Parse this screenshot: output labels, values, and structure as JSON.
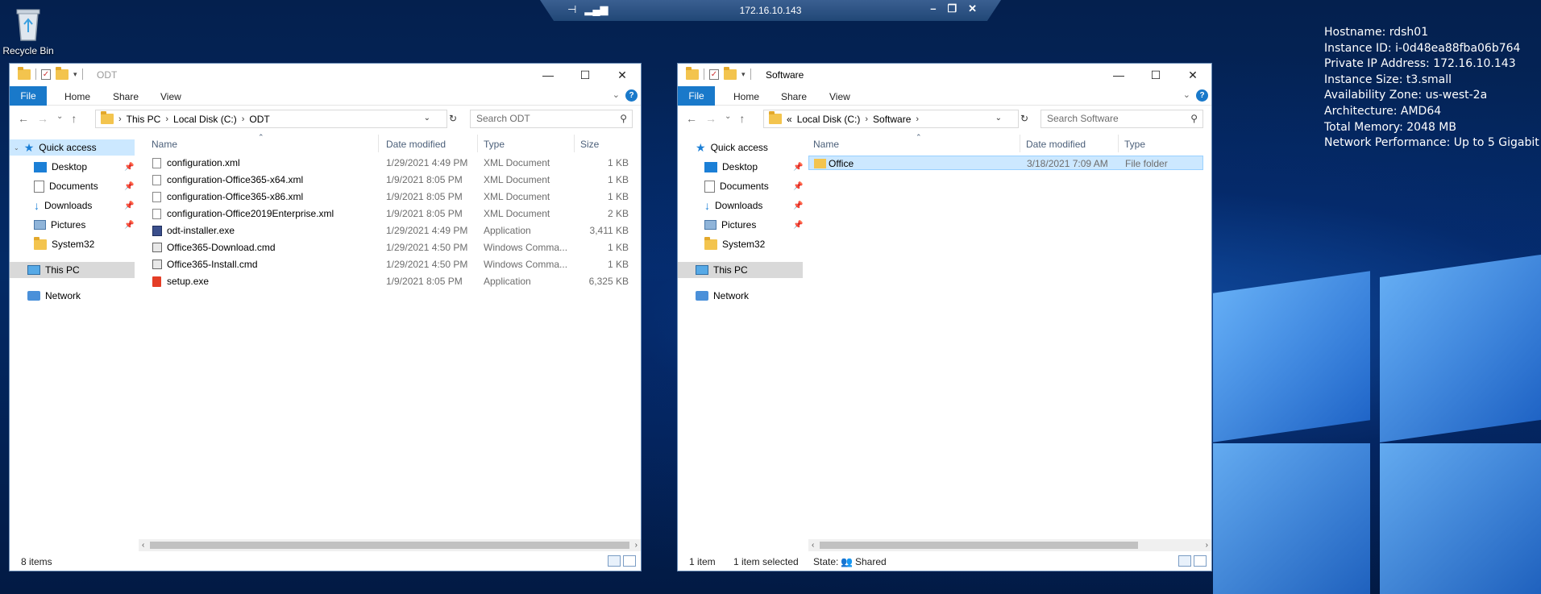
{
  "desktop": {
    "recycle_bin_label": "Recycle Bin"
  },
  "rdp_bar": {
    "ip": "172.16.10.143"
  },
  "sysinfo": [
    "Hostname: rdsh01",
    "Instance ID: i-0d48ea88fba06b764",
    "Private IP Address: 172.16.10.143",
    "Instance Size: t3.small",
    "Availability Zone: us-west-2a",
    "Architecture: AMD64",
    "Total Memory: 2048 MB",
    "Network Performance: Up to 5 Gigabit"
  ],
  "left_window": {
    "title": "ODT",
    "tabs": {
      "file": "File",
      "home": "Home",
      "share": "Share",
      "view": "View"
    },
    "breadcrumb": [
      "This PC",
      "Local Disk (C:)",
      "ODT"
    ],
    "search_placeholder": "Search ODT",
    "nav": {
      "quick_access": "Quick access",
      "desktop": "Desktop",
      "documents": "Documents",
      "downloads": "Downloads",
      "pictures": "Pictures",
      "system32": "System32",
      "this_pc": "This PC",
      "network": "Network"
    },
    "columns": {
      "name": "Name",
      "date": "Date modified",
      "type": "Type",
      "size": "Size"
    },
    "files": [
      {
        "name": "configuration.xml",
        "date": "1/29/2021 4:49 PM",
        "type": "XML Document",
        "size": "1 KB",
        "icon": "xml-file-icon"
      },
      {
        "name": "configuration-Office365-x64.xml",
        "date": "1/9/2021 8:05 PM",
        "type": "XML Document",
        "size": "1 KB",
        "icon": "xml-file-icon"
      },
      {
        "name": "configuration-Office365-x86.xml",
        "date": "1/9/2021 8:05 PM",
        "type": "XML Document",
        "size": "1 KB",
        "icon": "xml-file-icon"
      },
      {
        "name": "configuration-Office2019Enterprise.xml",
        "date": "1/9/2021 8:05 PM",
        "type": "XML Document",
        "size": "2 KB",
        "icon": "xml-file-icon"
      },
      {
        "name": "odt-installer.exe",
        "date": "1/29/2021 4:49 PM",
        "type": "Application",
        "size": "3,411 KB",
        "icon": "installer-icon"
      },
      {
        "name": "Office365-Download.cmd",
        "date": "1/29/2021 4:50 PM",
        "type": "Windows Comma...",
        "size": "1 KB",
        "icon": "cmd-file-icon"
      },
      {
        "name": "Office365-Install.cmd",
        "date": "1/29/2021 4:50 PM",
        "type": "Windows Comma...",
        "size": "1 KB",
        "icon": "cmd-file-icon"
      },
      {
        "name": "setup.exe",
        "date": "1/9/2021 8:05 PM",
        "type": "Application",
        "size": "6,325 KB",
        "icon": "office-setup-icon"
      }
    ],
    "status": {
      "count": "8 items"
    }
  },
  "right_window": {
    "title": "Software",
    "tabs": {
      "file": "File",
      "home": "Home",
      "share": "Share",
      "view": "View"
    },
    "breadcrumb_overflow": "«",
    "breadcrumb": [
      "Local Disk (C:)",
      "Software"
    ],
    "search_placeholder": "Search Software",
    "nav": {
      "quick_access": "Quick access",
      "desktop": "Desktop",
      "documents": "Documents",
      "downloads": "Downloads",
      "pictures": "Pictures",
      "system32": "System32",
      "this_pc": "This PC",
      "network": "Network"
    },
    "columns": {
      "name": "Name",
      "date": "Date modified",
      "type": "Type"
    },
    "files": [
      {
        "name": "Office",
        "date": "3/18/2021 7:09 AM",
        "type": "File folder",
        "icon": "folder-icon"
      }
    ],
    "status": {
      "count": "1 item",
      "selected": "1 item selected",
      "state_label": "State:",
      "state_value": "Shared"
    }
  }
}
